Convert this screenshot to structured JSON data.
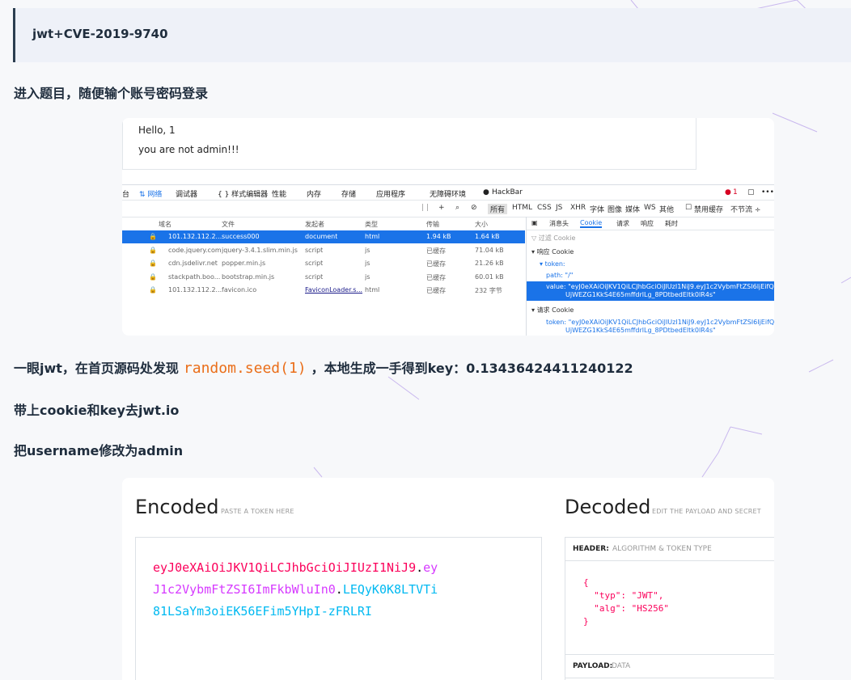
{
  "title": "jwt+CVE-2019-9740",
  "steps": {
    "login": "进入题目，随便输个账号密码登录",
    "found_prefix": "一眼jwt，在首页源码处发现",
    "found_code": "random.seed(1)",
    "found_suffix": "，本地生成一手得到key：0.13436424411240122",
    "cookie": "带上cookie和key去jwt.io",
    "username": "把username修改为admin"
  },
  "browser": {
    "hello": "Hello, 1",
    "not_admin": "you are not admin!!!",
    "toolbar": [
      "台",
      "⇅ 网络",
      "调试器",
      "{ } 样式编辑器",
      "性能",
      "内存",
      "存储",
      "应用程序",
      "无障碍环境",
      "HackBar"
    ],
    "error_count": "1",
    "filter_types": [
      "所有",
      "HTML",
      "CSS",
      "JS",
      "XHR",
      "字体",
      "图像",
      "媒体",
      "WS",
      "其他"
    ],
    "filter_right": [
      "禁用缓存",
      "不节流 ÷"
    ],
    "columns": [
      "域名",
      "文件",
      "发起者",
      "类型",
      "传输",
      "大小"
    ],
    "rows": [
      {
        "domain": "101.132.112.2...",
        "file": "success000",
        "initiator": "document",
        "type": "html",
        "transfer": "1.94 kB",
        "size": "1.64 kB",
        "selected": true
      },
      {
        "domain": "code.jquery.com",
        "file": "jquery-3.4.1.slim.min.js",
        "initiator": "script",
        "type": "js",
        "transfer": "已缓存",
        "size": "71.04 kB",
        "selected": false
      },
      {
        "domain": "cdn.jsdelivr.net",
        "file": "popper.min.js",
        "initiator": "script",
        "type": "js",
        "transfer": "已缓存",
        "size": "21.26 kB",
        "selected": false
      },
      {
        "domain": "stackpath.boo...",
        "file": "bootstrap.min.js",
        "initiator": "script",
        "type": "js",
        "transfer": "已缓存",
        "size": "60.01 kB",
        "selected": false
      },
      {
        "domain": "101.132.112.2...",
        "file": "favicon.ico",
        "initiator": "FaviconLoader.s...",
        "type": "html",
        "transfer": "已缓存",
        "size": "232 字节",
        "selected": false
      }
    ],
    "panel_tabs": [
      "消息头",
      "Cookie",
      "请求",
      "响应",
      "耗时"
    ],
    "filter_cookie": "过滤 Cookie",
    "resp_cookie": "响应 Cookie",
    "token_label": "token:",
    "path_line": "path: \"/\"",
    "value_line1": "value: \"eyJ0eXAiOiJKV1QiLCJhbGciOiJIUzI1NiJ9.eyJ1c2VybmFtZSI6IjEifQ.rvH-",
    "value_line2": "UjWEZG1KkS4E65mffdrlLg_8PDtbedEltk0lR4s\"",
    "req_cookie": "请求 Cookie",
    "req_line1": "token: \"eyJ0eXAiOiJKV1QiLCJhbGciOiJIUzI1NiJ9.eyJ1c2VybmFtZSI6IjEifQ.rvH-",
    "req_line2": "UjWEZG1KkS4E65mffdrlLg_8PDtbedEltk0lR4s\""
  },
  "jwt": {
    "encoded": "Encoded",
    "encoded_hint": "PASTE A TOKEN HERE",
    "decoded": "Decoded",
    "decoded_hint": "EDIT THE PAYLOAD AND SECRET",
    "tok_header_1": "eyJ0eXAiOiJKV1QiLCJhbGciOiJIUzI1NiJ9",
    "tok_payload_1": "ey",
    "tok_payload_2": "J1c2VybmFtZSI6ImFkbWluIn0",
    "tok_sig_1": "LEQyK0K8LTVTi",
    "tok_sig_2": "81LSaYm3oiEK56EFim5YHpI-zFRLRI",
    "dot": ".",
    "header_label": "HEADER:",
    "header_desc": "ALGORITHM & TOKEN TYPE",
    "header_json": "{\n  \"typ\": \"JWT\",\n  \"alg\": \"HS256\"\n}",
    "payload_label": "PAYLOAD:",
    "payload_desc": "DATA"
  }
}
